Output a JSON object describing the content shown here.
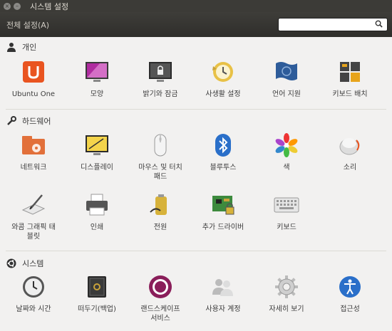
{
  "window": {
    "title": "시스템 설정"
  },
  "toolbar": {
    "all_settings": "전체 설정(A)",
    "search_placeholder": ""
  },
  "sections": {
    "personal": {
      "title": "개인",
      "items": [
        "Ubuntu One",
        "모양",
        "밝기와 잠금",
        "사생활 설정",
        "언어 지원",
        "키보드 배치"
      ]
    },
    "hardware": {
      "title": "하드웨어",
      "items": [
        "네트워크",
        "디스플레이",
        "마우스 및 터치\n패드",
        "블루투스",
        "색",
        "소리",
        "와콤 그래픽 태\n블릿",
        "인쇄",
        "전원",
        "추가 드라이버",
        "키보드"
      ]
    },
    "system": {
      "title": "시스템",
      "items": [
        "날짜와 시간",
        "떠두기(백업)",
        "랜드스케이프\n서비스",
        "사용자 계정",
        "자세히 보기",
        "접근성"
      ]
    }
  },
  "colors": {
    "titlebar": "#3c3b37",
    "background": "#f2f1f0",
    "ubuntu_orange": "#e95420"
  }
}
